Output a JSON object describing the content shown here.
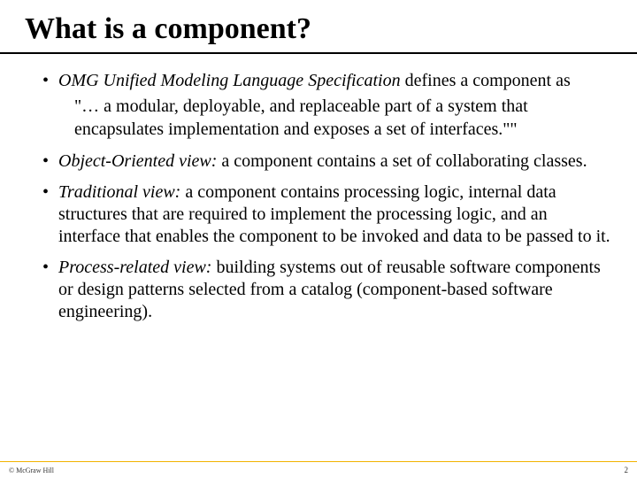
{
  "slide": {
    "title": "What is a component?",
    "bullets": [
      {
        "lead_italic": "OMG Unified Modeling Language Specification",
        "lead_plain": " defines a component as",
        "sub": "\"… a modular, deployable, and replaceable part of a system that encapsulates implementation and exposes a set of interfaces.\"\""
      },
      {
        "lead_italic": "Object-Oriented view:",
        "lead_plain": " a component contains a set of collaborating classes."
      },
      {
        "lead_italic": "Traditional view:",
        "lead_plain": " a component contains processing logic, internal data structures that are required to implement the processing logic, and an interface that enables the component to be invoked and data to be passed to it."
      },
      {
        "lead_italic": "Process-related view:",
        "lead_plain": " building systems out of reusable software components or design patterns selected from a catalog (component-based software engineering)."
      }
    ],
    "footer": {
      "copyright": "© McGraw Hill",
      "page_number": "2"
    }
  }
}
